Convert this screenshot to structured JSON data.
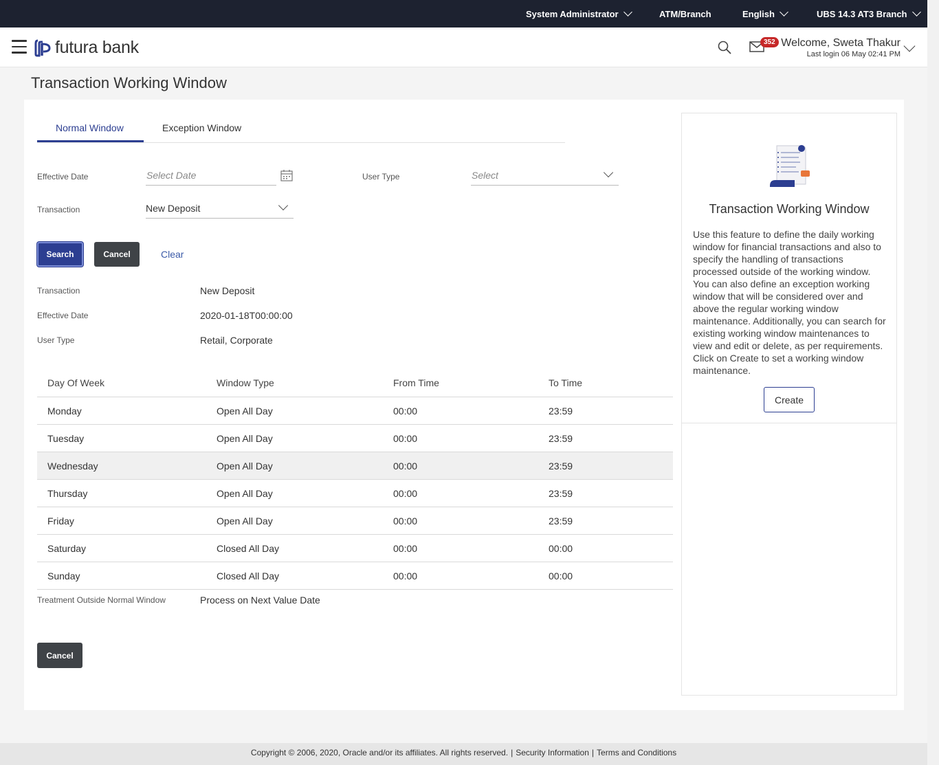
{
  "topbar": {
    "role": "System Administrator",
    "atm_branch": "ATM/Branch",
    "language": "English",
    "branch": "UBS 14.3 AT3 Branch"
  },
  "header": {
    "brand": "futura bank",
    "badge_count": "352",
    "welcome": "Welcome, Sweta Thakur",
    "last_login": "Last login 06 May 02:41 PM"
  },
  "page": {
    "title": "Transaction Working Window"
  },
  "tabs": [
    {
      "label": "Normal Window",
      "active": true
    },
    {
      "label": "Exception Window",
      "active": false
    }
  ],
  "form": {
    "effective_date_label": "Effective Date",
    "effective_date_placeholder": "Select Date",
    "user_type_label": "User Type",
    "user_type_placeholder": "Select",
    "transaction_label": "Transaction",
    "transaction_value": "New Deposit",
    "search_label": "Search",
    "cancel_label": "Cancel",
    "clear_label": "Clear"
  },
  "details": {
    "transaction_label": "Transaction",
    "transaction_value": "New Deposit",
    "effective_date_label": "Effective Date",
    "effective_date_value": "2020-01-18T00:00:00",
    "user_type_label": "User Type",
    "user_type_value": "Retail, Corporate"
  },
  "table": {
    "headers": [
      "Day Of Week",
      "Window Type",
      "From Time",
      "To Time"
    ],
    "rows": [
      [
        "Monday",
        "Open All Day",
        "00:00",
        "23:59"
      ],
      [
        "Tuesday",
        "Open All Day",
        "00:00",
        "23:59"
      ],
      [
        "Wednesday",
        "Open All Day",
        "00:00",
        "23:59"
      ],
      [
        "Thursday",
        "Open All Day",
        "00:00",
        "23:59"
      ],
      [
        "Friday",
        "Open All Day",
        "00:00",
        "23:59"
      ],
      [
        "Saturday",
        "Closed All Day",
        "00:00",
        "00:00"
      ],
      [
        "Sunday",
        "Closed All Day",
        "00:00",
        "00:00"
      ]
    ]
  },
  "treatment": {
    "label": "Treatment Outside Normal Window",
    "value": "Process on Next Value Date"
  },
  "bottom_cancel_label": "Cancel",
  "help": {
    "title": "Transaction Working Window",
    "text": "Use this feature to define the daily working window for financial transactions and also to specify the handling of transactions processed outside of the working window. You can also define an exception working window that will be considered over and above the regular working window maintenance. Additionally, you can search for existing working window maintenances to view and edit or delete, as per requirements. Click on Create to set a working window maintenance.",
    "create_label": "Create"
  },
  "footer": {
    "copyright": "Copyright © 2006, 2020, Oracle and/or its affiliates. All rights reserved.",
    "security": "Security Information",
    "terms": "Terms and Conditions"
  },
  "colors": {
    "primary": "#2c3e91",
    "topbar": "#1d2230",
    "badge": "#c62828",
    "dark_button": "#3f4347"
  }
}
